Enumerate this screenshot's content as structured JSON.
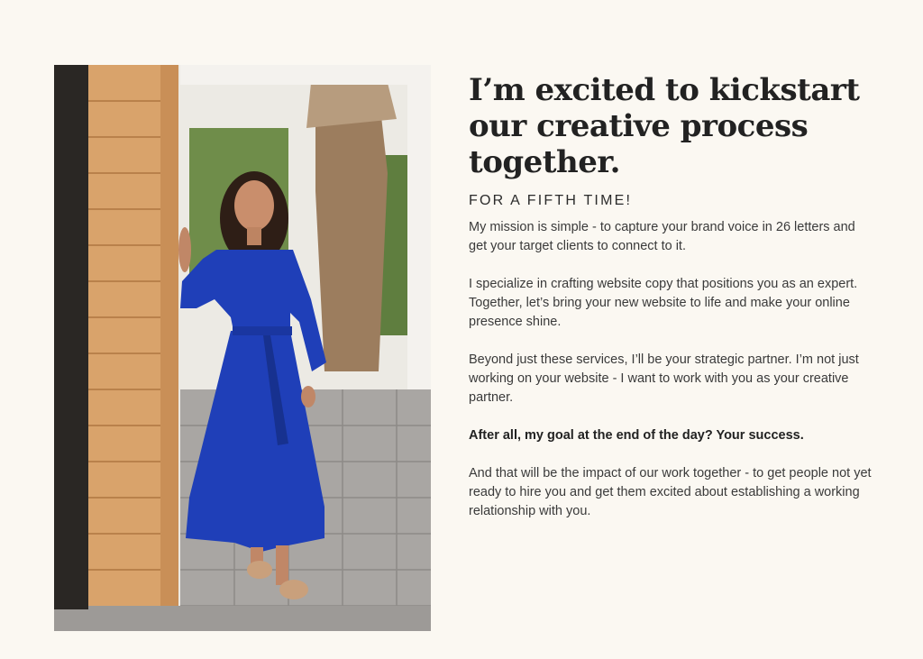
{
  "heading": {
    "line1": "I’m excited to kickstart",
    "line2": "our creative process",
    "line3": "together."
  },
  "subheading": "FOR A FIFTH TIME!",
  "paragraphs": {
    "p1": "My mission is simple - to capture your brand voice in 26 letters and get your target clients to connect to it.",
    "p2": "I specialize in crafting website copy that positions you as an expert. Together, let’s bring your new website to life and make your online presence shine.",
    "p3": "Beyond just these services, I’ll be your strategic partner. I’m not just working on your website - I want to work with you as your creative partner.",
    "p4": "After all, my goal at the end of the day? Your success.",
    "p5": "And that will be the impact of our work together - to get people not yet ready to hire you and get them excited about establishing a working relationship with you."
  },
  "colors": {
    "background": "#fbf8f2",
    "dress": "#1f3fb8",
    "wood": "#d9a36b"
  }
}
